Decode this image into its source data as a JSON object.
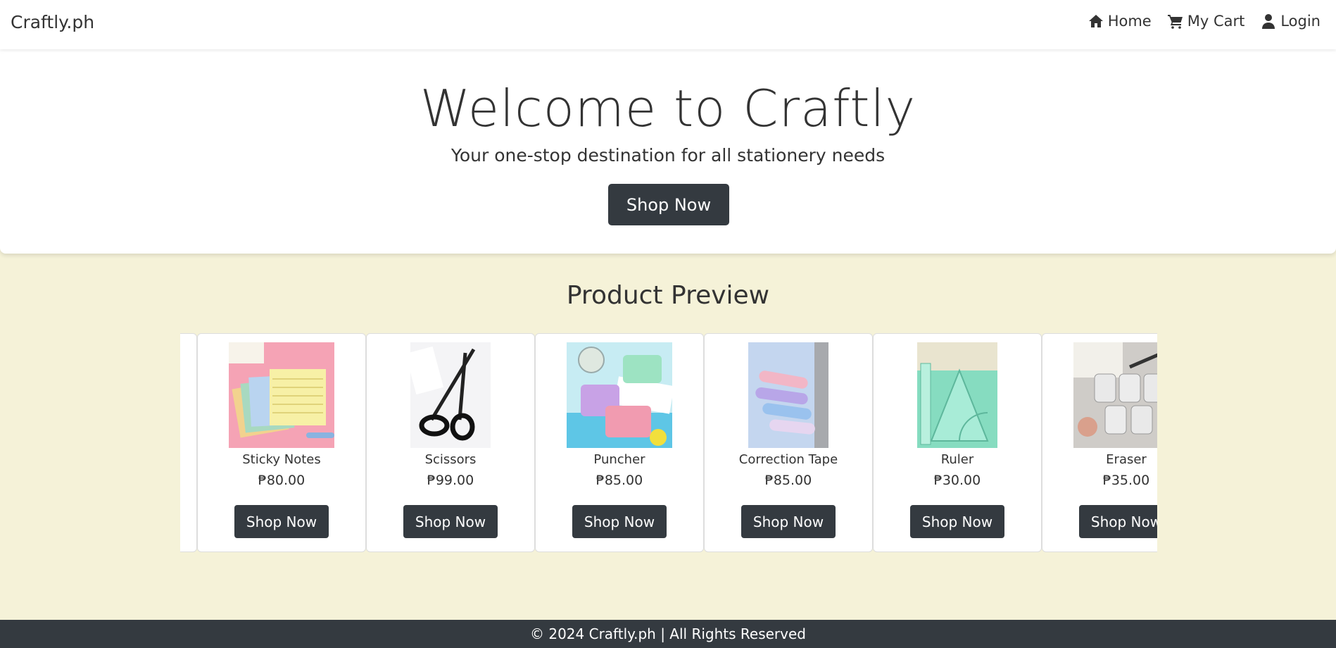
{
  "navbar": {
    "brand": "Craftly.ph",
    "links": [
      {
        "label": "Home",
        "icon": "home-icon"
      },
      {
        "label": "My Cart",
        "icon": "cart-icon"
      },
      {
        "label": "Login",
        "icon": "user-icon"
      }
    ]
  },
  "hero": {
    "title": "Welcome to Craftly",
    "subtitle": "Your one-stop destination for all stationery needs",
    "button_label": "Shop Now"
  },
  "preview": {
    "title": "Product Preview",
    "products": [
      {
        "name": "Sticky Notes",
        "price": "₱80.00",
        "button_label": "Shop Now"
      },
      {
        "name": "Scissors",
        "price": "₱99.00",
        "button_label": "Shop Now"
      },
      {
        "name": "Puncher",
        "price": "₱85.00",
        "button_label": "Shop Now"
      },
      {
        "name": "Correction Tape",
        "price": "₱85.00",
        "button_label": "Shop Now"
      },
      {
        "name": "Ruler",
        "price": "₱30.00",
        "button_label": "Shop Now"
      },
      {
        "name": "Eraser",
        "price": "₱35.00",
        "button_label": "Shop Now"
      }
    ]
  },
  "footer": {
    "text": "© 2024 Craftly.ph | All Rights Reserved"
  },
  "colors": {
    "page_background": "#f5f2d8",
    "button": "#343a40",
    "footer": "#343a40"
  }
}
